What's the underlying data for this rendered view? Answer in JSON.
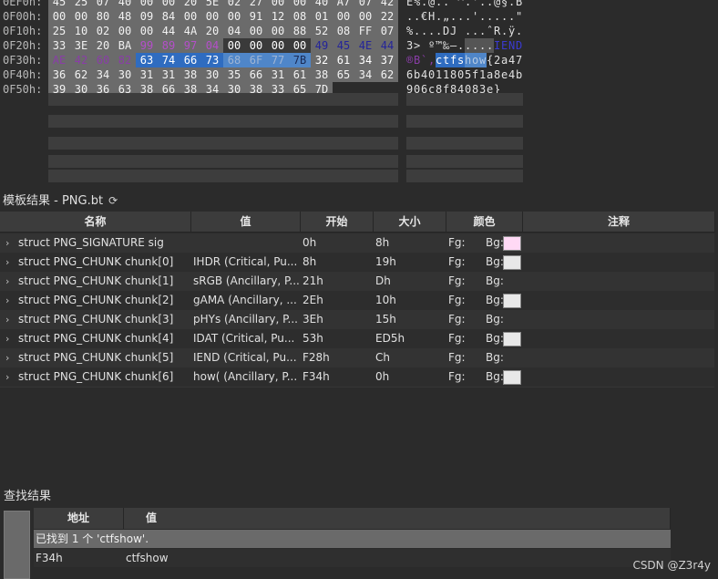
{
  "hex_editor": {
    "rows": [
      {
        "addr": "0EF0h:",
        "bytes": [
          "45",
          "25",
          "07",
          "40",
          "00",
          "00",
          "20",
          "5E",
          "02",
          "27",
          "00",
          "00",
          "40",
          "A7",
          "07",
          "42"
        ],
        "ascii": "E%.@.. ^.'..@§.B"
      },
      {
        "addr": "0F00h:",
        "bytes": [
          "00",
          "00",
          "80",
          "48",
          "09",
          "84",
          "00",
          "00",
          "00",
          "91",
          "12",
          "08",
          "01",
          "00",
          "00",
          "22"
        ],
        "ascii": "..€H.„...'.....\""
      },
      {
        "addr": "0F10h:",
        "bytes": [
          "25",
          "10",
          "02",
          "00",
          "00",
          "44",
          "4A",
          "20",
          "04",
          "00",
          "00",
          "88",
          "52",
          "08",
          "FF",
          "07"
        ],
        "ascii": "%....DJ ...ˆR.ÿ."
      },
      {
        "addr": "0F20h:",
        "bytes": [
          "33",
          "3E",
          "20",
          "BA",
          "99",
          "89",
          "97",
          "04",
          "00",
          "00",
          "00",
          "00",
          "49",
          "45",
          "4E",
          "44"
        ],
        "ascii": "3> º™‰—.....IEND"
      },
      {
        "addr": "0F30h:",
        "bytes": [
          "AE",
          "42",
          "60",
          "82",
          "63",
          "74",
          "66",
          "73",
          "68",
          "6F",
          "77",
          "7B",
          "32",
          "61",
          "34",
          "37"
        ],
        "ascii": "®B`‚ctfshow{2a47"
      },
      {
        "addr": "0F40h:",
        "bytes": [
          "36",
          "62",
          "34",
          "30",
          "31",
          "31",
          "38",
          "30",
          "35",
          "66",
          "31",
          "61",
          "38",
          "65",
          "34",
          "62"
        ],
        "ascii": "6b4011805f1a8e4b"
      },
      {
        "addr": "0F50h:",
        "bytes": [
          "39",
          "30",
          "36",
          "63",
          "38",
          "66",
          "38",
          "34",
          "30",
          "38",
          "33",
          "65",
          "7D"
        ],
        "ascii": "906c8f84083e}"
      }
    ],
    "colors": {
      "selection": "#2f6cc0",
      "selection_light": "#4f86c9",
      "sig_purple": "#8a3da8",
      "chunk_crc": "#3838a0",
      "gray_block": "#6b6b6b",
      "dark_block": "#3a3a3a"
    }
  },
  "template_results": {
    "title": "模板结果 - PNG.bt",
    "refresh_icon": "⟳",
    "columns": [
      "名称",
      "值",
      "开始",
      "大小",
      "颜色",
      "注释"
    ],
    "rows": [
      {
        "name": "struct PNG_SIGNATURE sig",
        "value": "",
        "start": "0h",
        "size": "8h",
        "fg": "Fg:",
        "bg": "Bg:",
        "bg_color": "#ffd9f5"
      },
      {
        "name": "struct PNG_CHUNK chunk[0]",
        "value": "IHDR  (Critical, Pu...",
        "start": "8h",
        "size": "19h",
        "fg": "Fg:",
        "bg": "Bg:",
        "bg_color": "#e8e8e8"
      },
      {
        "name": "struct PNG_CHUNK chunk[1]",
        "value": "sRGB  (Ancillary, P...",
        "start": "21h",
        "size": "Dh",
        "fg": "Fg:",
        "bg": "Bg:",
        "bg_color": ""
      },
      {
        "name": "struct PNG_CHUNK chunk[2]",
        "value": "gAMA  (Ancillary, ...",
        "start": "2Eh",
        "size": "10h",
        "fg": "Fg:",
        "bg": "Bg:",
        "bg_color": "#e8e8e8"
      },
      {
        "name": "struct PNG_CHUNK chunk[3]",
        "value": "pHYs  (Ancillary, P...",
        "start": "3Eh",
        "size": "15h",
        "fg": "Fg:",
        "bg": "Bg:",
        "bg_color": ""
      },
      {
        "name": "struct PNG_CHUNK chunk[4]",
        "value": "IDAT  (Critical, Pu...",
        "start": "53h",
        "size": "ED5h",
        "fg": "Fg:",
        "bg": "Bg:",
        "bg_color": "#e8e8e8"
      },
      {
        "name": "struct PNG_CHUNK chunk[5]",
        "value": "IEND  (Critical, Pu...",
        "start": "F28h",
        "size": "Ch",
        "fg": "Fg:",
        "bg": "Bg:",
        "bg_color": ""
      },
      {
        "name": "struct PNG_CHUNK chunk[6]",
        "value": "how(  (Ancillary, P...",
        "start": "F34h",
        "size": "0h",
        "fg": "Fg:",
        "bg": "Bg:",
        "bg_color": "#e8e8e8"
      }
    ]
  },
  "find_results": {
    "title": "查找结果",
    "columns": [
      "地址",
      "值"
    ],
    "message": "已找到 1 个 'ctfshow'.",
    "rows": [
      {
        "address": "F34h",
        "value": "ctfshow"
      }
    ]
  },
  "watermark": "CSDN @Z3r4y"
}
